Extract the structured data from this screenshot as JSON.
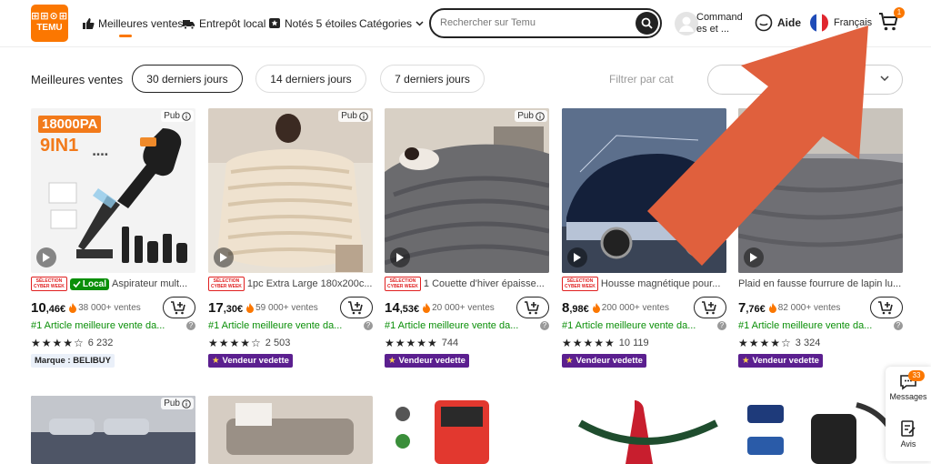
{
  "header": {
    "logo_line1": "⊞⊞⊙⊞",
    "logo_line2": "TEMU",
    "nav": [
      "Meilleures ventes",
      "Entrepôt local",
      "Notés 5 étoiles",
      "Catégories"
    ],
    "search_placeholder": "Rechercher sur Temu",
    "account_line1": "Command",
    "account_line2": "es et ...",
    "help": "Aide",
    "language": "Français",
    "cart_count": "1"
  },
  "filters": {
    "label": "Meilleures ventes",
    "periods": [
      "30 derniers jours",
      "14 derniers jours",
      "7 derniers jours"
    ],
    "active_period": "30 derniers jours",
    "category_placeholder": "Filtrer par cat"
  },
  "common": {
    "pub": "Pub",
    "cyber_line1": "SÉLECTION",
    "cyber_line2": "CYBER WEEK",
    "local": "Local",
    "featured": "Vendeur vedette",
    "currency": "€"
  },
  "products": [
    {
      "cyber": true,
      "local": true,
      "title": "Aspirateur mult...",
      "price_int": "10",
      "price_dec": ",46€",
      "sold": "38 000+ ventes",
      "best": "#1 Article meilleure vente da...",
      "stars": "★★★★☆",
      "rating_count": "6 232",
      "tag": "Marque : BELIBUY",
      "tag_type": "brand",
      "pub": true
    },
    {
      "cyber": true,
      "local": false,
      "title": "1pc Extra Large 180x200c...",
      "price_int": "17",
      "price_dec": ",30€",
      "sold": "59 000+ ventes",
      "best": "#1 Article meilleure vente da...",
      "stars": "★★★★☆",
      "rating_count": "2 503",
      "tag": "Vendeur vedette",
      "tag_type": "vedette",
      "pub": true
    },
    {
      "cyber": true,
      "local": false,
      "title": "1 Couette d'hiver épaisse...",
      "price_int": "14",
      "price_dec": ",53€",
      "sold": "20 000+ ventes",
      "best": "#1 Article meilleure vente da...",
      "stars": "★★★★★",
      "rating_count": "744",
      "tag": "Vendeur vedette",
      "tag_type": "vedette",
      "pub": true
    },
    {
      "cyber": true,
      "local": false,
      "title": "Housse magnétique pour...",
      "price_int": "8",
      "price_dec": ",98€",
      "sold": "200 000+ ventes",
      "best": "#1 Article meilleure vente da...",
      "stars": "★★★★★",
      "rating_count": "10 119",
      "tag": "Vendeur vedette",
      "tag_type": "vedette",
      "pub": false
    },
    {
      "cyber": false,
      "local": false,
      "title": "Plaid en fausse fourrure de lapin lu...",
      "price_int": "7",
      "price_dec": ",76€",
      "sold": "82 000+ ventes",
      "best": "#1 Article meilleure vente da...",
      "stars": "★★★★☆",
      "rating_count": "3 324",
      "tag": "Vendeur vedette",
      "tag_type": "vedette",
      "pub": false
    }
  ],
  "image_text": {
    "p1_badge": "18000PA",
    "p1_sub": "9IN1"
  },
  "sidebar": {
    "messages_count": "33",
    "messages": "Messages",
    "avis": "Avis"
  },
  "colors": {
    "brand": "#fb7701",
    "success": "#0a8f08",
    "vedette": "#5b1f8f",
    "arrow": "#e0603d"
  }
}
